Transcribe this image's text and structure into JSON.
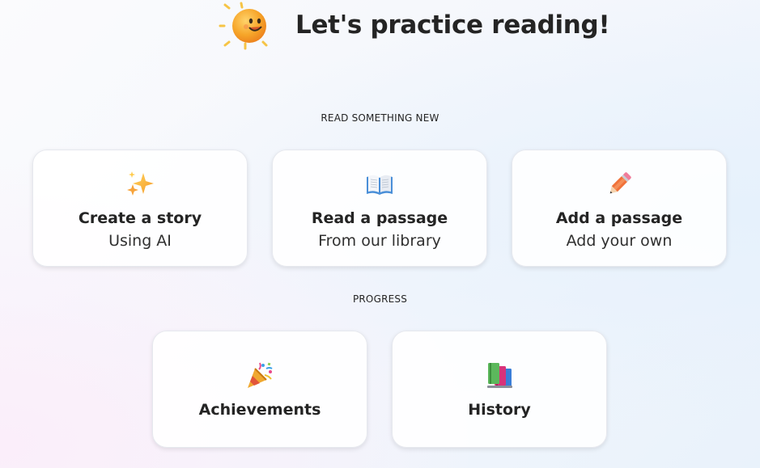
{
  "header": {
    "title": "Let's practice reading!",
    "mascot_icon": "smiling-sun-icon"
  },
  "sections": {
    "new": {
      "label": "READ SOMETHING NEW",
      "cards": [
        {
          "icon": "sparkles-icon",
          "title": "Create a story",
          "subtitle": "Using AI"
        },
        {
          "icon": "open-book-icon",
          "title": "Read a passage",
          "subtitle": "From our library"
        },
        {
          "icon": "pencil-icon",
          "title": "Add a passage",
          "subtitle": "Add your own"
        }
      ]
    },
    "progress": {
      "label": "PROGRESS",
      "cards": [
        {
          "icon": "party-popper-icon",
          "title": "Achievements"
        },
        {
          "icon": "books-icon",
          "title": "History"
        }
      ]
    }
  },
  "colors": {
    "sun": "#f5a523",
    "card_border": "#e6e8ee",
    "text": "#242424"
  }
}
